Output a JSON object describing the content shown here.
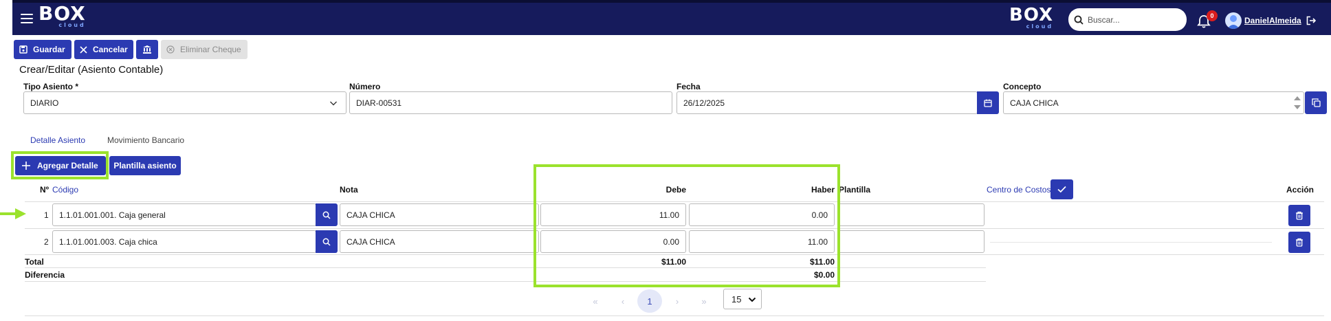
{
  "app": {
    "logo_text": "BOX",
    "logo_sub": "cloud",
    "search_placeholder": "Buscar...",
    "notifications_count": "0",
    "user_name": "DanielAlmeida"
  },
  "toolbar": {
    "save_label": "Guardar",
    "cancel_label": "Cancelar",
    "delete_check_label": "Eliminar Cheque"
  },
  "page": {
    "title": "Crear/Editar (Asiento Contable)"
  },
  "form": {
    "tipo_asiento_label": "Tipo Asiento *",
    "tipo_asiento_value": "DIARIO",
    "numero_label": "Número",
    "numero_value": "DIAR-00531",
    "fecha_label": "Fecha",
    "fecha_value": "26/12/2025",
    "concepto_label": "Concepto",
    "concepto_value": "CAJA CHICA"
  },
  "tabs": [
    {
      "label": "Detalle Asiento",
      "active": true
    },
    {
      "label": "Movimiento Bancario",
      "active": false
    }
  ],
  "actions": {
    "add_detail_label": "Agregar Detalle",
    "template_label": "Plantilla asiento"
  },
  "table": {
    "headers": {
      "num": "Nº",
      "code": "Código",
      "note": "Nota",
      "debit": "Debe",
      "credit": "Haber",
      "template": "Plantilla",
      "cost_center": "Centro de Costos",
      "action": "Acción"
    },
    "rows": [
      {
        "num": "1",
        "code": "1.1.01.001.001. Caja general",
        "note": "CAJA CHICA",
        "debit": "11.00",
        "credit": "0.00",
        "template": ""
      },
      {
        "num": "2",
        "code": "1.1.01.001.003. Caja chica",
        "note": "CAJA CHICA",
        "debit": "0.00",
        "credit": "11.00",
        "template": ""
      }
    ],
    "total_label": "Total",
    "total_debit": "$11.00",
    "total_credit": "$11.00",
    "difference_label": "Diferencia",
    "difference_value": "$0.00"
  },
  "pagination": {
    "first": "«",
    "prev": "‹",
    "current_page": "1",
    "next": "›",
    "last": "»",
    "page_size": "15"
  },
  "colors": {
    "navbar": "#161b5c",
    "primary": "#2b3ab2",
    "highlight": "#9be22d",
    "badge": "#d91e1e"
  }
}
